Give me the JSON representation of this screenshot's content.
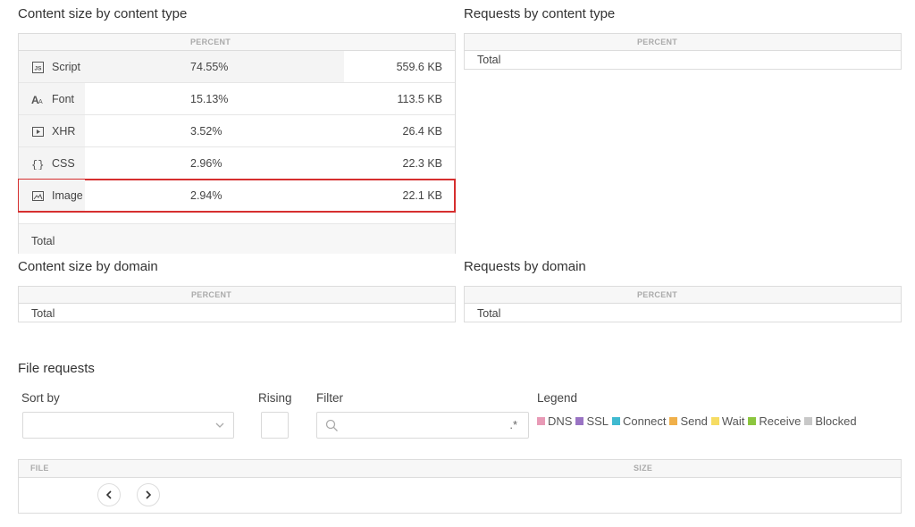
{
  "content_type": {
    "title": "Content size by content type",
    "header_percent": "PERCENT",
    "rows": [
      {
        "icon": "js-icon",
        "name": "Script",
        "percent": "74.55%",
        "size": "559.6 KB",
        "bar_fraction": 0.7455
      },
      {
        "icon": "font-icon",
        "name": "Font",
        "percent": "15.13%",
        "size": "113.5 KB",
        "bar_fraction": 0.1513
      },
      {
        "icon": "xhr-icon",
        "name": "XHR",
        "percent": "3.52%",
        "size": "26.4 KB",
        "bar_fraction": 0.0352
      },
      {
        "icon": "css-icon",
        "name": "CSS",
        "percent": "2.96%",
        "size": "22.3 KB",
        "bar_fraction": 0.0296
      },
      {
        "icon": "image-icon",
        "name": "Image",
        "percent": "2.94%",
        "size": "22.1 KB",
        "bar_fraction": 0.0294
      }
    ],
    "total_label": "Total"
  },
  "requests_type": {
    "title": "Requests by content type",
    "header_percent": "PERCENT",
    "total_label": "Total"
  },
  "content_domain": {
    "title": "Content size by domain",
    "header_percent": "PERCENT",
    "total_label": "Total"
  },
  "requests_domain": {
    "title": "Requests by domain",
    "header_percent": "PERCENT",
    "total_label": "Total"
  },
  "file_requests": {
    "title": "File requests",
    "sort_by_label": "Sort by",
    "rising_label": "Rising",
    "filter_label": "Filter",
    "filter_regex": ".*",
    "legend_label": "Legend",
    "legend": [
      {
        "name": "DNS",
        "color": "#e89ab6"
      },
      {
        "name": "SSL",
        "color": "#9a74c4"
      },
      {
        "name": "Connect",
        "color": "#3fbad0"
      },
      {
        "name": "Send",
        "color": "#f0b04a"
      },
      {
        "name": "Wait",
        "color": "#f6dc63"
      },
      {
        "name": "Receive",
        "color": "#8cc63f"
      },
      {
        "name": "Blocked",
        "color": "#c8c8c8"
      }
    ],
    "col_file": "FILE",
    "col_size": "SIZE"
  }
}
